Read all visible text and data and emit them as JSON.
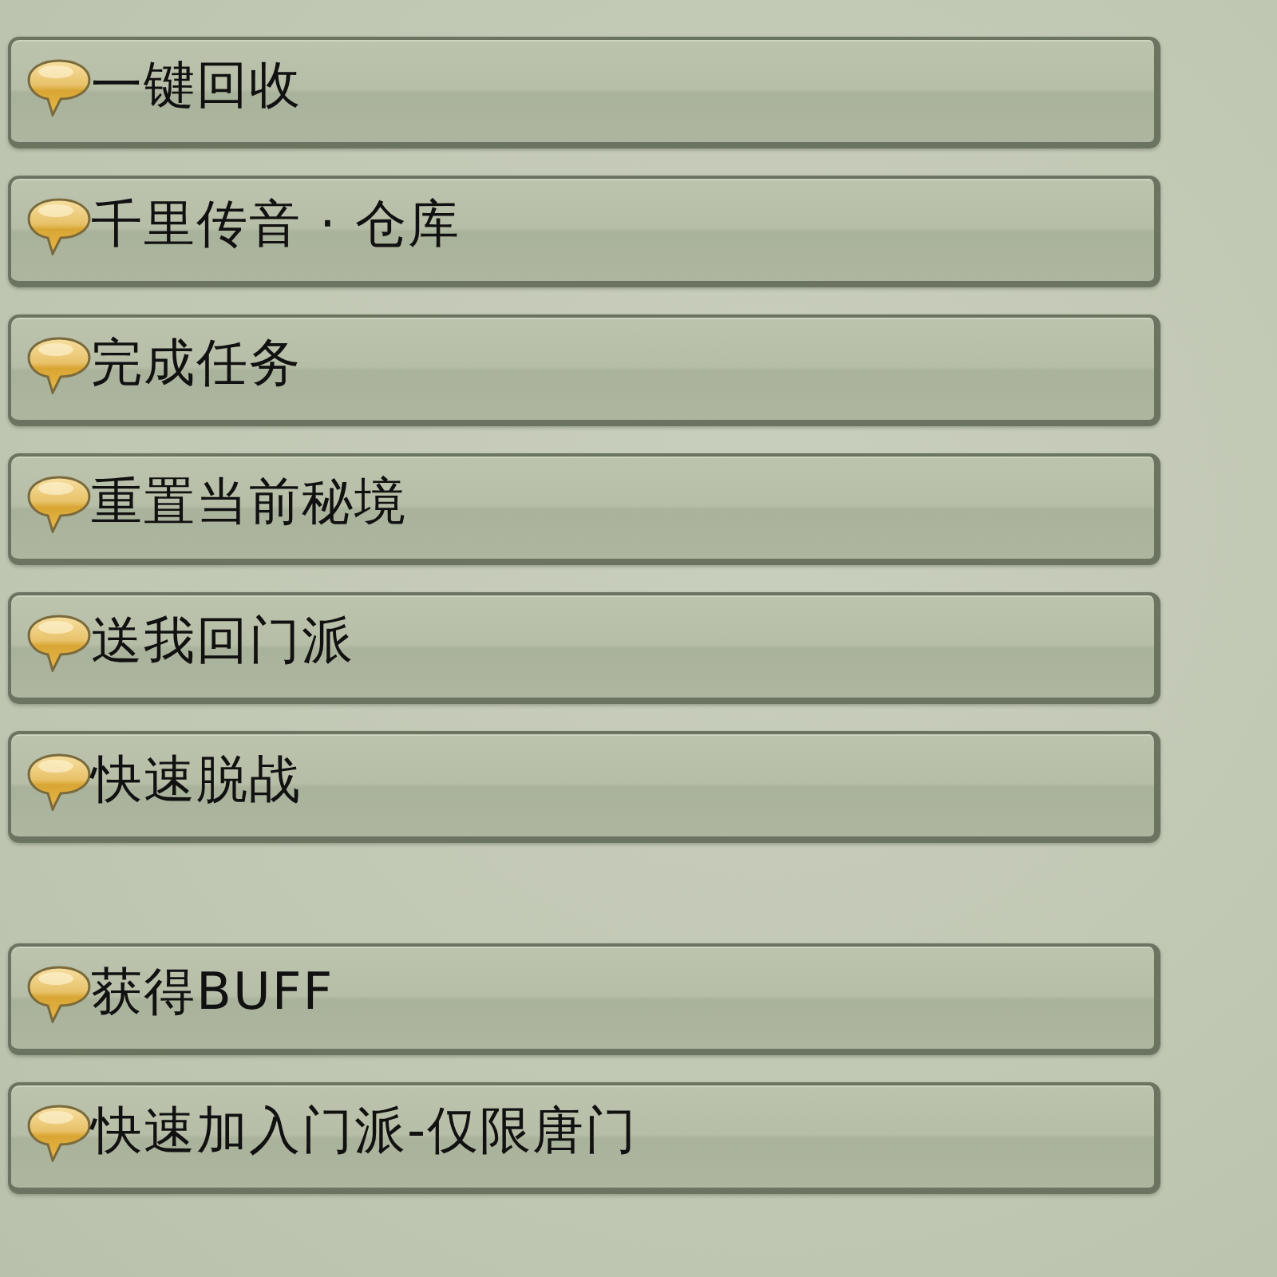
{
  "option_groups": [
    {
      "options": [
        {
          "label": "一键回收"
        },
        {
          "label": "千里传音 · 仓库"
        },
        {
          "label": "完成任务"
        },
        {
          "label": "重置当前秘境"
        },
        {
          "label": "送我回门派"
        },
        {
          "label": "快速脱战"
        }
      ]
    },
    {
      "options": [
        {
          "label": "获得BUFF"
        },
        {
          "label": "快速加入门派-仅限唐门"
        }
      ]
    }
  ]
}
